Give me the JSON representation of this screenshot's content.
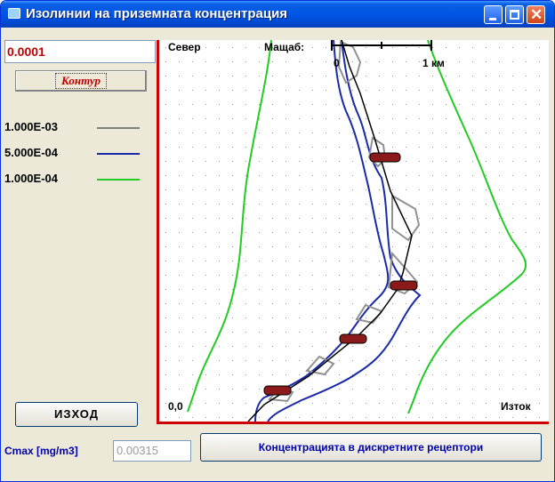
{
  "window": {
    "title": "Изолинии на приземната концентрация",
    "accent": "#0055e5"
  },
  "controls": {
    "contour_value": "0.0001",
    "contour_button": "Контур",
    "exit_button": "ИЗХОД",
    "cmax_label": "Cmax [mg/m3]",
    "cmax_value": "0.00315",
    "receptors_button": "Концентрацията в дискретните рецептори"
  },
  "legend": [
    {
      "label": "1.000E-03",
      "color": "#808080"
    },
    {
      "label": "5.000E-04",
      "color": "#1a2aa8"
    },
    {
      "label": "1.000E-04",
      "color": "#22cc22"
    }
  ],
  "plot": {
    "north_label": "Север",
    "scale_label": "Мащаб:",
    "scale_start": "0",
    "scale_end": "1 км",
    "origin_label": "0,0",
    "east_label": "Изток",
    "axis_color": "#cc0000"
  }
}
